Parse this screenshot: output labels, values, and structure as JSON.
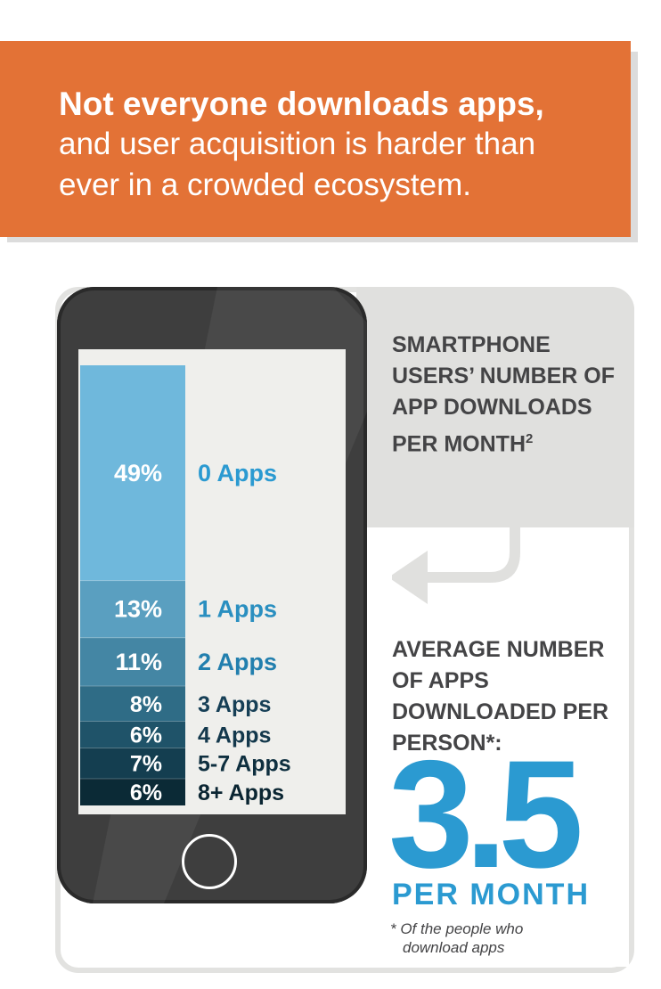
{
  "banner": {
    "headline_bold": "Not everyone downloads apps,",
    "headline_line2": "and user acquisition is harder than",
    "headline_line3": "ever in a crowded ecosystem."
  },
  "chart_data": {
    "type": "bar",
    "title": "SMARTPHONE USERS’ NUMBER OF APP DOWNLOADS PER MONTH",
    "title_footnote_marker": "2",
    "orientation": "stacked-vertical",
    "categories": [
      "0 Apps",
      "1 Apps",
      "2 Apps",
      "3 Apps",
      "4 Apps",
      "5-7 Apps",
      "8+ Apps"
    ],
    "values": [
      49,
      13,
      11,
      8,
      6,
      7,
      6
    ],
    "value_labels": [
      "49%",
      "13%",
      "11%",
      "8%",
      "6%",
      "7%",
      "6%"
    ],
    "unit": "%",
    "colors": [
      "#6fb8dc",
      "#5a9fc0",
      "#4486a4",
      "#2f6c86",
      "#1f5369",
      "#143e50",
      "#0b2a36"
    ],
    "label_colors": [
      "#2b9ad1",
      "#2a8fc0",
      "#227fae",
      "#163f56",
      "#13384c",
      "#0e2f3f",
      "#0a2532"
    ]
  },
  "average": {
    "label": "AVERAGE NUMBER OF APPS DOWNLOADED PER PERSON*:",
    "value": "3.5",
    "unit": "PER MONTH",
    "footnote_line1": "* Of the people who",
    "footnote_line2": "download apps"
  },
  "colors": {
    "banner": "#e37236",
    "accent_blue": "#2b9ad1",
    "text_dark": "#444446",
    "phone": "#3e3e3e",
    "panel_grey": "#e0e0de"
  }
}
